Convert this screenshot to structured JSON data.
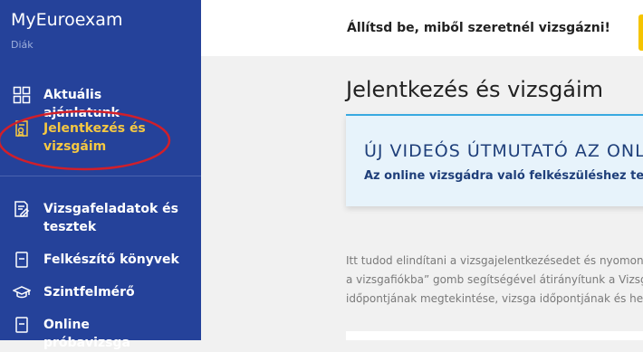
{
  "sidebar": {
    "brand": "MyEuroexam",
    "role": "Diák",
    "items": [
      {
        "label": "Aktuális ajánlatunk",
        "icon": "grid-icon"
      },
      {
        "label": "Jelentkezés és vizsgáim",
        "icon": "certificate-icon",
        "active": true
      },
      {
        "label": "Vizsgafeladatok és tesztek",
        "icon": "edit-document-icon"
      },
      {
        "label": "Felkészítő könyvek",
        "icon": "book-icon"
      },
      {
        "label": "Szintfelmérő",
        "icon": "graduation-cap-icon"
      },
      {
        "label": "Online próbavizsga",
        "icon": "book-icon"
      }
    ]
  },
  "topbar": {
    "text": "Állítsd be, miből szeretnél vizsgázni!"
  },
  "main": {
    "title": "Jelentkezés és vizsgáim",
    "info_title": "ÚJ VIDEÓS ÚTMUTATÓ AZ ONLINE",
    "info_sub": "Az online vizsgádra való felkészüléshez tekintsd meg",
    "body_lines": [
      "Itt tudod elindítani a vizsgajelentkezésedet és nyomon követni",
      "a vizsgafiókba” gomb segítségével átirányítunk a Vizsgafiókba,",
      "időpontjának megtekintése, vizsga időpontjának és helyszínének"
    ]
  },
  "colors": {
    "sidebar_bg": "#25429a",
    "active_label": "#f5c842",
    "accent_yellow": "#f5c400",
    "annotation_red": "#d11f2a",
    "info_bg": "#e7f3fb",
    "info_text": "#1f3f7a"
  }
}
